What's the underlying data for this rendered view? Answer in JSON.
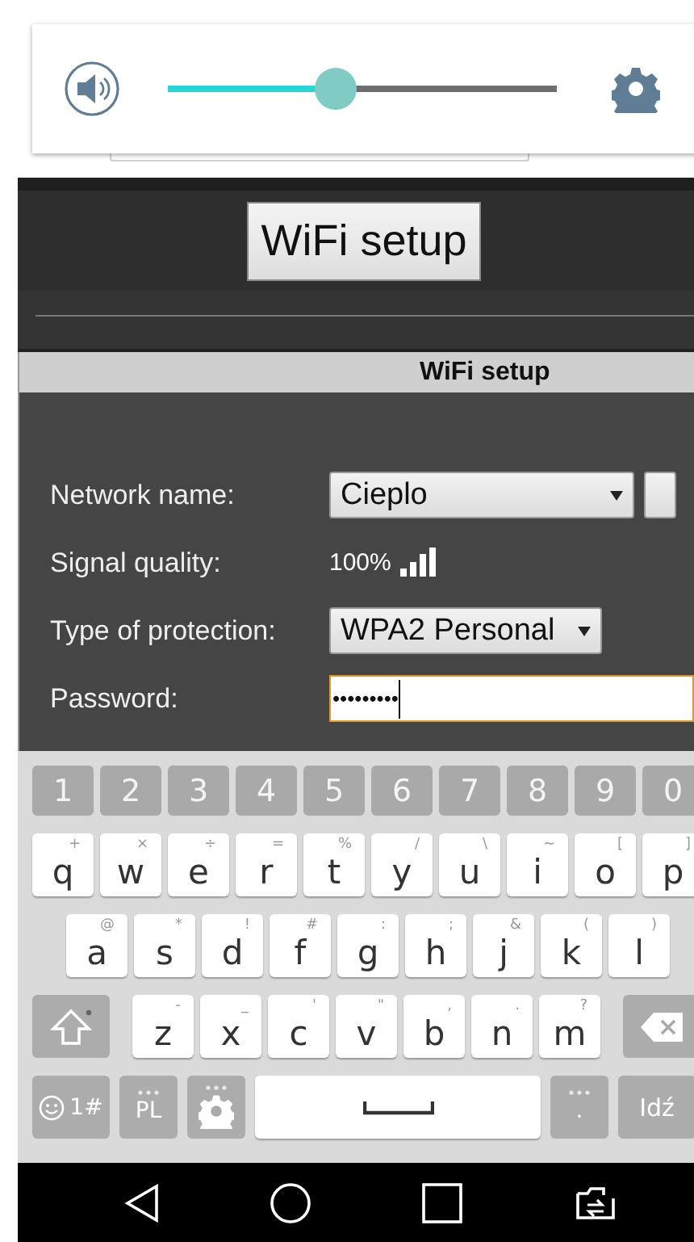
{
  "volume_panel": {
    "level": 0.43
  },
  "page_button": "WiFi setup",
  "dialog": {
    "title": "WiFi setup",
    "rows": [
      {
        "kind": "select",
        "label": "Network name:",
        "value": "Cieplo",
        "side_button": true
      },
      {
        "kind": "signal",
        "label": "Signal quality:",
        "value": "100%"
      },
      {
        "kind": "select",
        "label": "Type of protection:",
        "value": "WPA2 Personal",
        "side_button": false
      },
      {
        "kind": "password",
        "label": "Password:",
        "value": "•••••••••"
      }
    ]
  },
  "keyboard": {
    "number_row": [
      "1",
      "2",
      "3",
      "4",
      "5",
      "6",
      "7",
      "8",
      "9",
      "0"
    ],
    "letter_rows": [
      [
        {
          "key": "q",
          "hint": "+"
        },
        {
          "key": "w",
          "hint": "×"
        },
        {
          "key": "e",
          "hint": "÷"
        },
        {
          "key": "r",
          "hint": "="
        },
        {
          "key": "t",
          "hint": "%"
        },
        {
          "key": "y",
          "hint": "/"
        },
        {
          "key": "u",
          "hint": "\\"
        },
        {
          "key": "i",
          "hint": "~"
        },
        {
          "key": "o",
          "hint": "["
        },
        {
          "key": "p",
          "hint": "]"
        }
      ],
      [
        {
          "key": "a",
          "hint": "@"
        },
        {
          "key": "s",
          "hint": "*"
        },
        {
          "key": "d",
          "hint": "!"
        },
        {
          "key": "f",
          "hint": "#"
        },
        {
          "key": "g",
          "hint": ":"
        },
        {
          "key": "h",
          "hint": ";"
        },
        {
          "key": "j",
          "hint": "&"
        },
        {
          "key": "k",
          "hint": "("
        },
        {
          "key": "l",
          "hint": ")"
        }
      ],
      [
        {
          "key": "z",
          "hint": "-"
        },
        {
          "key": "x",
          "hint": "_"
        },
        {
          "key": "c",
          "hint": "'"
        },
        {
          "key": "v",
          "hint": "\""
        },
        {
          "key": "b",
          "hint": ","
        },
        {
          "key": "n",
          "hint": "."
        },
        {
          "key": "m",
          "hint": "?"
        }
      ]
    ],
    "bottom_row": [
      {
        "kind": "emoji",
        "label": "1#"
      },
      {
        "kind": "language",
        "label": "PL"
      },
      {
        "kind": "settings"
      },
      {
        "kind": "space"
      },
      {
        "kind": "period",
        "label": "."
      },
      {
        "kind": "enter",
        "label": "Idź"
      }
    ]
  }
}
